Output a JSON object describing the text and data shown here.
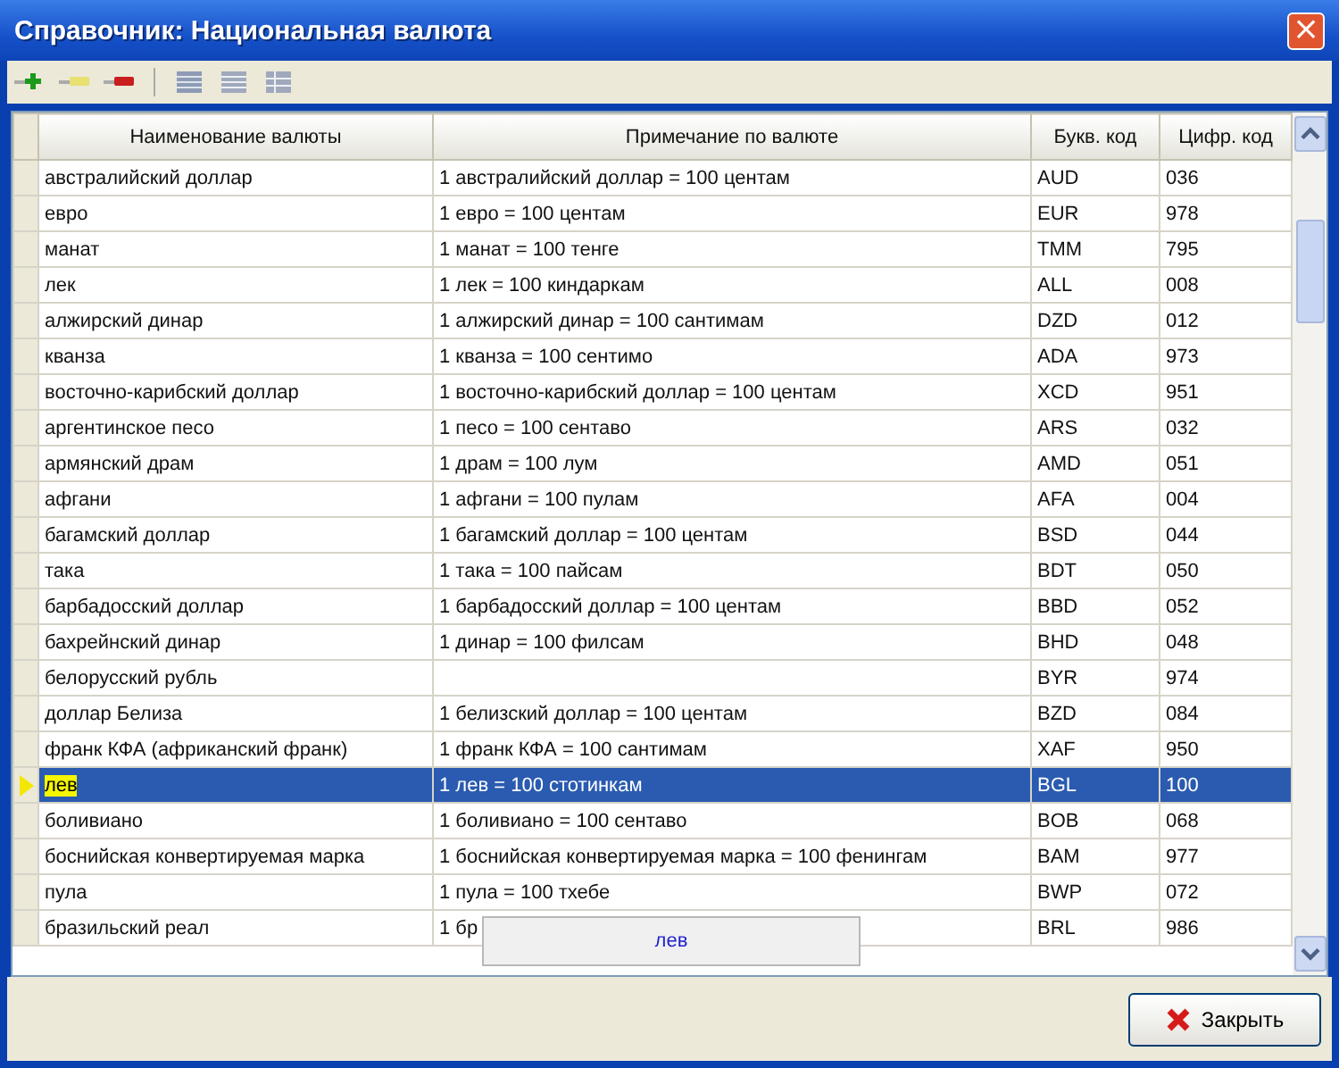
{
  "window": {
    "title": "Справочник: Национальная валюта",
    "close_glyph": "×"
  },
  "table": {
    "columns": [
      "Наименование валюты",
      "Примечание по валюте",
      "Букв. код",
      "Цифр. код"
    ],
    "rows": [
      {
        "name": "австралийский доллар",
        "note": "1 австралийский доллар = 100 центам",
        "alpha": "AUD",
        "num": "036",
        "selected": false
      },
      {
        "name": "евро",
        "note": "1 евро = 100 центам",
        "alpha": "EUR",
        "num": "978",
        "selected": false
      },
      {
        "name": "манат",
        "note": "1 манат = 100 тенге",
        "alpha": "TMM",
        "num": "795",
        "selected": false
      },
      {
        "name": "лек",
        "note": "1 лек = 100 киндаркам",
        "alpha": "ALL",
        "num": "008",
        "selected": false
      },
      {
        "name": "алжирский динар",
        "note": "1 алжирский динар = 100 сантимам",
        "alpha": "DZD",
        "num": "012",
        "selected": false
      },
      {
        "name": "кванза",
        "note": "1 кванза = 100 сентимо",
        "alpha": "ADA",
        "num": "973",
        "selected": false
      },
      {
        "name": "восточно-карибский доллар",
        "note": "1 восточно-карибский доллар = 100 центам",
        "alpha": "XCD",
        "num": "951",
        "selected": false
      },
      {
        "name": "аргентинское песо",
        "note": "1 песо = 100 сентаво",
        "alpha": "ARS",
        "num": "032",
        "selected": false
      },
      {
        "name": "армянский драм",
        "note": "1 драм = 100 лум",
        "alpha": "AMD",
        "num": "051",
        "selected": false
      },
      {
        "name": "афгани",
        "note": "1 афгани = 100 пулам",
        "alpha": "AFA",
        "num": "004",
        "selected": false
      },
      {
        "name": "багамский доллар",
        "note": "1 багамский доллар = 100 центам",
        "alpha": "BSD",
        "num": "044",
        "selected": false
      },
      {
        "name": "така",
        "note": "1 така = 100 пайсам",
        "alpha": "BDT",
        "num": "050",
        "selected": false
      },
      {
        "name": "барбадосский доллар",
        "note": "1 барбадосский доллар = 100 центам",
        "alpha": "BBD",
        "num": "052",
        "selected": false
      },
      {
        "name": "бахрейнский динар",
        "note": "1 динар = 100 филсам",
        "alpha": "BHD",
        "num": "048",
        "selected": false
      },
      {
        "name": "белорусский рубль",
        "note": "",
        "alpha": "BYR",
        "num": "974",
        "selected": false
      },
      {
        "name": "доллар Белиза",
        "note": "1 белизский доллар = 100 центам",
        "alpha": "BZD",
        "num": "084",
        "selected": false
      },
      {
        "name": "франк КФА (африканский франк)",
        "note": "1 франк КФА = 100 сантимам",
        "alpha": "XAF",
        "num": "950",
        "selected": false
      },
      {
        "name": "лев",
        "note": "1 лев = 100 стотинкам",
        "alpha": "BGL",
        "num": "100",
        "selected": true
      },
      {
        "name": "боливиано",
        "note": "1 боливиано = 100 сентаво",
        "alpha": "BOB",
        "num": "068",
        "selected": false
      },
      {
        "name": "боснийская конвертируемая марка",
        "note": "1 боснийская конвертируемая марка = 100 фенингам",
        "alpha": "BAM",
        "num": "977",
        "selected": false
      },
      {
        "name": "пула",
        "note": "1 пула = 100 тхебе",
        "alpha": "BWP",
        "num": "072",
        "selected": false
      },
      {
        "name": "бразильский реал",
        "note": "1 бр",
        "alpha": "BRL",
        "num": "986",
        "selected": false
      }
    ]
  },
  "tooltip": {
    "text": "лев"
  },
  "buttons": [
    {
      "label": "Закрыть"
    }
  ]
}
